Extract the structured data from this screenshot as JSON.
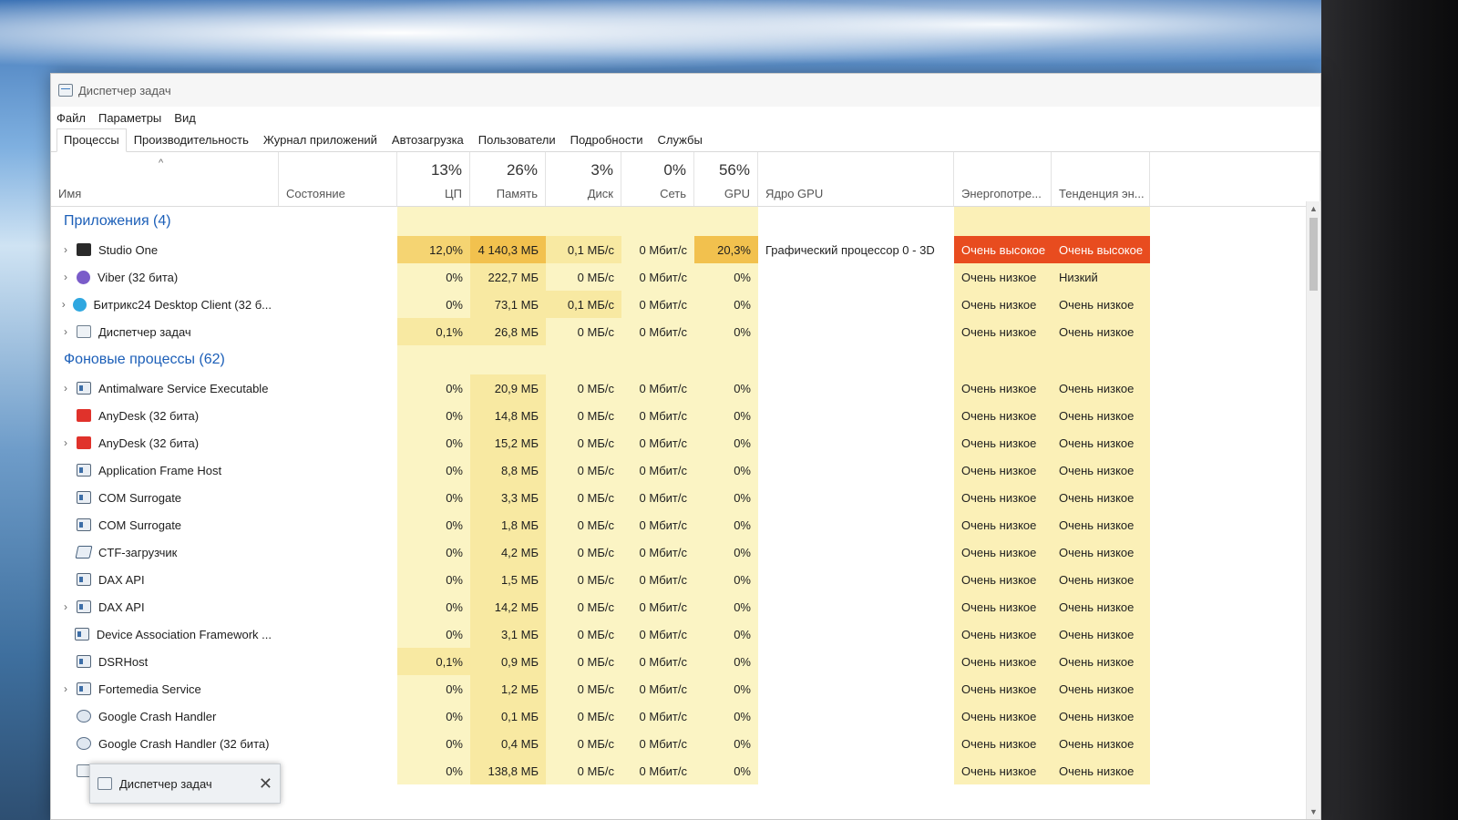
{
  "window": {
    "title": "Диспетчер задач"
  },
  "menu": [
    "Файл",
    "Параметры",
    "Вид"
  ],
  "tabs": [
    {
      "label": "Процессы",
      "active": true
    },
    {
      "label": "Производительность"
    },
    {
      "label": "Журнал приложений"
    },
    {
      "label": "Автозагрузка"
    },
    {
      "label": "Пользователи"
    },
    {
      "label": "Подробности"
    },
    {
      "label": "Службы"
    }
  ],
  "columns": {
    "name": "Имя",
    "status": "Состояние",
    "cpu": {
      "pct": "13%",
      "label": "ЦП"
    },
    "memory": {
      "pct": "26%",
      "label": "Память"
    },
    "disk": {
      "pct": "3%",
      "label": "Диск"
    },
    "network": {
      "pct": "0%",
      "label": "Сеть"
    },
    "gpu": {
      "pct": "56%",
      "label": "GPU"
    },
    "gpu_engine": "Ядро GPU",
    "power": "Энергопотре...",
    "power_trend": "Тенденция эн..."
  },
  "groups": [
    {
      "title": "Приложения (4)",
      "rows": [
        {
          "expand": true,
          "icon": "studio-one-icon",
          "name": "Studio One",
          "cpu": "12,0%",
          "mem": "4 140,3 МБ",
          "disk": "0,1 МБ/с",
          "net": "0 Мбит/с",
          "gpu": "20,3%",
          "engine": "Графический процессор 0 - 3D",
          "power": "Очень высокое",
          "trend": "Очень высокое",
          "heat": "high"
        },
        {
          "expand": true,
          "icon": "viber-icon",
          "name": "Viber (32 бита)",
          "cpu": "0%",
          "mem": "222,7 МБ",
          "disk": "0 МБ/с",
          "net": "0 Мбит/с",
          "gpu": "0%",
          "engine": "",
          "power": "Очень низкое",
          "trend": "Низкий"
        },
        {
          "expand": true,
          "icon": "bitrix24-icon",
          "name": "Битрикс24 Desktop Client (32 б...",
          "cpu": "0%",
          "mem": "73,1 МБ",
          "disk": "0,1 МБ/с",
          "net": "0 Мбит/с",
          "gpu": "0%",
          "engine": "",
          "power": "Очень низкое",
          "trend": "Очень низкое"
        },
        {
          "expand": true,
          "icon": "task-manager-icon",
          "name": "Диспетчер задач",
          "cpu": "0,1%",
          "mem": "26,8 МБ",
          "disk": "0 МБ/с",
          "net": "0 Мбит/с",
          "gpu": "0%",
          "engine": "",
          "power": "Очень низкое",
          "trend": "Очень низкое"
        }
      ]
    },
    {
      "title": "Фоновые процессы (62)",
      "rows": [
        {
          "expand": true,
          "icon": "service-window-icon",
          "name": "Antimalware Service Executable",
          "cpu": "0%",
          "mem": "20,9 МБ",
          "disk": "0 МБ/с",
          "net": "0 Мбит/с",
          "gpu": "0%",
          "engine": "",
          "power": "Очень низкое",
          "trend": "Очень низкое"
        },
        {
          "expand": false,
          "icon": "anydesk-icon",
          "name": "AnyDesk (32 бита)",
          "cpu": "0%",
          "mem": "14,8 МБ",
          "disk": "0 МБ/с",
          "net": "0 Мбит/с",
          "gpu": "0%",
          "engine": "",
          "power": "Очень низкое",
          "trend": "Очень низкое"
        },
        {
          "expand": true,
          "icon": "anydesk-icon",
          "name": "AnyDesk (32 бита)",
          "cpu": "0%",
          "mem": "15,2 МБ",
          "disk": "0 МБ/с",
          "net": "0 Мбит/с",
          "gpu": "0%",
          "engine": "",
          "power": "Очень низкое",
          "trend": "Очень низкое"
        },
        {
          "expand": false,
          "icon": "service-window-icon",
          "name": "Application Frame Host",
          "cpu": "0%",
          "mem": "8,8 МБ",
          "disk": "0 МБ/с",
          "net": "0 Мбит/с",
          "gpu": "0%",
          "engine": "",
          "power": "Очень низкое",
          "trend": "Очень низкое"
        },
        {
          "expand": false,
          "icon": "service-window-icon",
          "name": "COM Surrogate",
          "cpu": "0%",
          "mem": "3,3 МБ",
          "disk": "0 МБ/с",
          "net": "0 Мбит/с",
          "gpu": "0%",
          "engine": "",
          "power": "Очень низкое",
          "trend": "Очень низкое"
        },
        {
          "expand": false,
          "icon": "service-window-icon",
          "name": "COM Surrogate",
          "cpu": "0%",
          "mem": "1,8 МБ",
          "disk": "0 МБ/с",
          "net": "0 Мбит/с",
          "gpu": "0%",
          "engine": "",
          "power": "Очень низкое",
          "trend": "Очень низкое"
        },
        {
          "expand": false,
          "icon": "pen-icon",
          "name": "CTF-загрузчик",
          "cpu": "0%",
          "mem": "4,2 МБ",
          "disk": "0 МБ/с",
          "net": "0 Мбит/с",
          "gpu": "0%",
          "engine": "",
          "power": "Очень низкое",
          "trend": "Очень низкое"
        },
        {
          "expand": false,
          "icon": "service-window-icon",
          "name": "DAX API",
          "cpu": "0%",
          "mem": "1,5 МБ",
          "disk": "0 МБ/с",
          "net": "0 Мбит/с",
          "gpu": "0%",
          "engine": "",
          "power": "Очень низкое",
          "trend": "Очень низкое"
        },
        {
          "expand": true,
          "icon": "service-window-icon",
          "name": "DAX API",
          "cpu": "0%",
          "mem": "14,2 МБ",
          "disk": "0 МБ/с",
          "net": "0 Мбит/с",
          "gpu": "0%",
          "engine": "",
          "power": "Очень низкое",
          "trend": "Очень низкое"
        },
        {
          "expand": false,
          "icon": "service-window-icon",
          "name": "Device Association Framework ...",
          "cpu": "0%",
          "mem": "3,1 МБ",
          "disk": "0 МБ/с",
          "net": "0 Мбит/с",
          "gpu": "0%",
          "engine": "",
          "power": "Очень низкое",
          "trend": "Очень низкое"
        },
        {
          "expand": false,
          "icon": "service-window-icon",
          "name": "DSRHost",
          "cpu": "0,1%",
          "mem": "0,9 МБ",
          "disk": "0 МБ/с",
          "net": "0 Мбит/с",
          "gpu": "0%",
          "engine": "",
          "power": "Очень низкое",
          "trend": "Очень низкое"
        },
        {
          "expand": true,
          "icon": "service-window-icon",
          "name": "Fortemedia Service",
          "cpu": "0%",
          "mem": "1,2 МБ",
          "disk": "0 МБ/с",
          "net": "0 Мбит/с",
          "gpu": "0%",
          "engine": "",
          "power": "Очень низкое",
          "trend": "Очень низкое"
        },
        {
          "expand": false,
          "icon": "google-crash-icon",
          "name": "Google Crash Handler",
          "cpu": "0%",
          "mem": "0,1 МБ",
          "disk": "0 МБ/с",
          "net": "0 Мбит/с",
          "gpu": "0%",
          "engine": "",
          "power": "Очень низкое",
          "trend": "Очень низкое"
        },
        {
          "expand": false,
          "icon": "google-crash-icon",
          "name": "Google Crash Handler (32 бита)",
          "cpu": "0%",
          "mem": "0,4 МБ",
          "disk": "0 МБ/с",
          "net": "0 Мбит/с",
          "gpu": "0%",
          "engine": "",
          "power": "Очень низкое",
          "trend": "Очень низкое"
        },
        {
          "expand": false,
          "icon": "task-manager-icon",
          "name": "",
          "cpu": "0%",
          "mem": "138,8 МБ",
          "disk": "0 МБ/с",
          "net": "0 Мбит/с",
          "gpu": "0%",
          "engine": "",
          "power": "Очень низкое",
          "trend": "Очень низкое"
        }
      ]
    }
  ],
  "taskbar_preview": {
    "title": "Диспетчер задач",
    "close": "✕"
  }
}
